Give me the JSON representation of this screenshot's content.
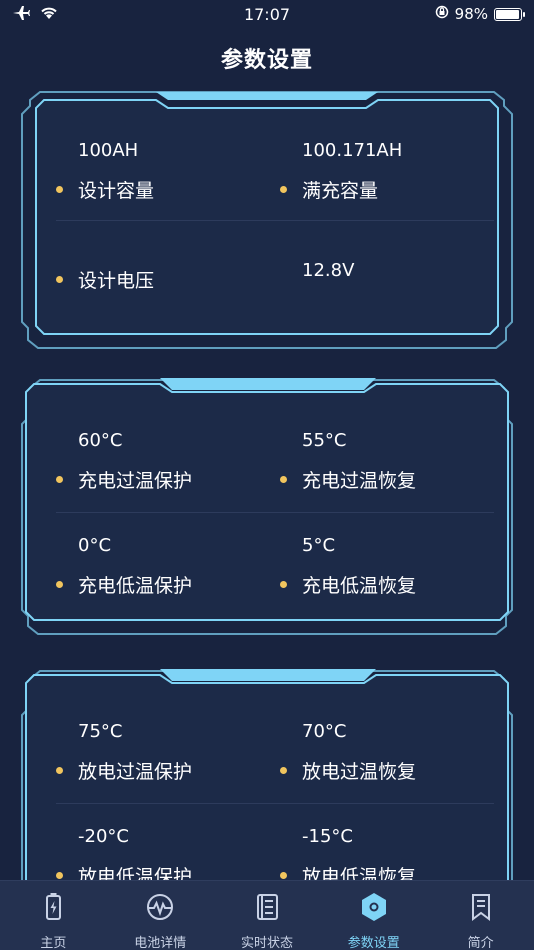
{
  "status_bar": {
    "time": "17:07",
    "battery": "98%"
  },
  "nav": {
    "title": "参数设置"
  },
  "cards": [
    {
      "rows": [
        [
          {
            "value": "100AH",
            "label": "设计容量"
          },
          {
            "value": "100.171AH",
            "label": "满充容量"
          }
        ],
        [
          {
            "value": "",
            "label": "设计电压"
          },
          {
            "value": "12.8V",
            "label": ""
          }
        ]
      ]
    },
    {
      "rows": [
        [
          {
            "value": "60°C",
            "label": "充电过温保护"
          },
          {
            "value": "55°C",
            "label": "充电过温恢复"
          }
        ],
        [
          {
            "value": "0°C",
            "label": "充电低温保护"
          },
          {
            "value": "5°C",
            "label": "充电低温恢复"
          }
        ]
      ]
    },
    {
      "rows": [
        [
          {
            "value": "75°C",
            "label": "放电过温保护"
          },
          {
            "value": "70°C",
            "label": "放电过温恢复"
          }
        ],
        [
          {
            "value": "-20°C",
            "label": "放电低温保护"
          },
          {
            "value": "-15°C",
            "label": "放电低温恢复"
          }
        ]
      ]
    }
  ],
  "tabs": [
    {
      "label": "主页",
      "icon": "battery-icon",
      "active": false
    },
    {
      "label": "电池详情",
      "icon": "pulse-icon",
      "active": false
    },
    {
      "label": "实时状态",
      "icon": "list-document-icon",
      "active": false
    },
    {
      "label": "参数设置",
      "icon": "hexagon-settings-icon",
      "active": true
    },
    {
      "label": "简介",
      "icon": "bookmark-icon",
      "active": false
    }
  ],
  "colors": {
    "background": "#18233f",
    "card_border": "#7fd4f6",
    "label_dot": "#f1c55e",
    "tab_active": "#7fd4f6",
    "tab_inactive": "#c9d2e6"
  }
}
